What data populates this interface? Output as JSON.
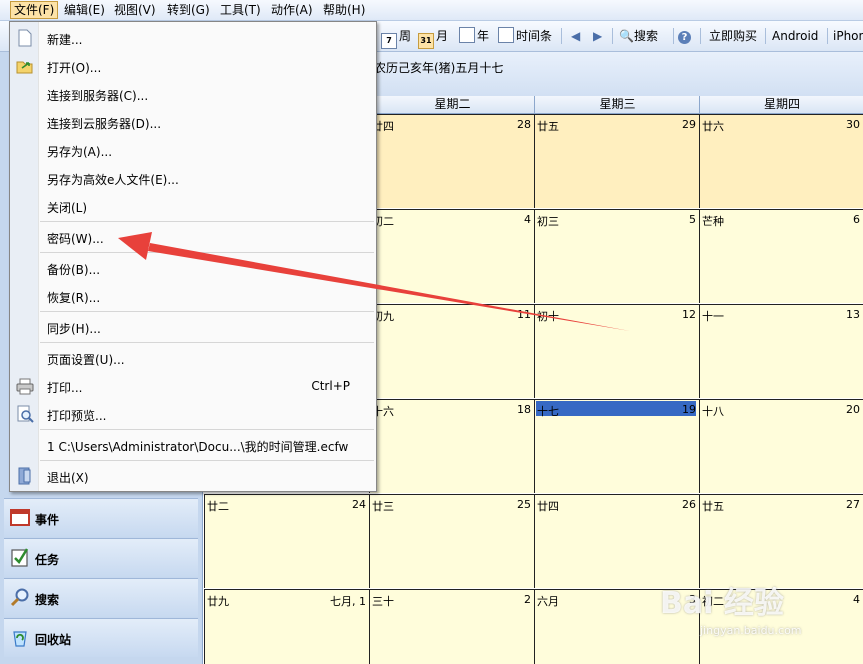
{
  "menubar": {
    "items": [
      {
        "label": "文件(F)"
      },
      {
        "label": "编辑(E)"
      },
      {
        "label": "视图(V)"
      },
      {
        "label": "转到(G)"
      },
      {
        "label": "工具(T)"
      },
      {
        "label": "动作(A)"
      },
      {
        "label": "帮助(H)"
      }
    ]
  },
  "toolbar": {
    "week_label": "周",
    "month_label": "月",
    "month_icon_text": "31",
    "year_label": "年",
    "timeline_label": "时间条",
    "search_label": "搜索",
    "buy_label": "立即购买",
    "android_label": "Android",
    "iphone_label": "iPhon"
  },
  "date_header": {
    "lunar_text": "农历己亥年(猪)五月十七"
  },
  "calendar": {
    "weekday_headers": [
      "星期二",
      "星期三",
      "星期四"
    ],
    "rows": [
      [
        {
          "lunar": "廿四",
          "day": "28"
        },
        {
          "lunar": "廿五",
          "day": "29"
        },
        {
          "lunar": "廿六",
          "day": "30"
        }
      ],
      [
        {
          "lunar": "初二",
          "day": "4"
        },
        {
          "lunar": "初三",
          "day": "5"
        },
        {
          "lunar": "芒种",
          "day": "6"
        }
      ],
      [
        {
          "lunar": "初九",
          "day": "11"
        },
        {
          "lunar": "初十",
          "day": "12"
        },
        {
          "lunar": "十一",
          "day": "13"
        }
      ],
      [
        {
          "lunar": "十六",
          "day": "18"
        },
        {
          "lunar": "十七",
          "day": "19"
        },
        {
          "lunar": "十八",
          "day": "20"
        }
      ],
      [
        {
          "lunar": "廿二",
          "day": "24"
        },
        {
          "lunar": "廿三",
          "day": "25"
        },
        {
          "lunar": "廿四",
          "day": "26"
        },
        {
          "lunar": "廿五",
          "day": "27"
        }
      ],
      [
        {
          "lunar": "廿九",
          "day": "七月, 1"
        },
        {
          "lunar": "三十",
          "day": "2"
        },
        {
          "lunar": "六月",
          "day": "3"
        },
        {
          "lunar": "初二",
          "day": "4"
        }
      ]
    ],
    "selected_day": "19"
  },
  "nav": {
    "events": "事件",
    "tasks": "任务",
    "search": "搜索",
    "recycle": "回收站"
  },
  "file_menu": {
    "new": "新建...",
    "open": "打开(O)...",
    "connect_server": "连接到服务器(C)...",
    "connect_cloud": "连接到云服务器(D)...",
    "save_as": "另存为(A)...",
    "save_as_ecf": "另存为高效e人文件(E)...",
    "close": "关闭(L)",
    "password": "密码(W)...",
    "backup": "备份(B)...",
    "restore": "恢复(R)...",
    "sync": "同步(H)...",
    "page_setup": "页面设置(U)...",
    "print": "打印...",
    "print_shortcut": "Ctrl+P",
    "print_preview": "打印预览...",
    "recent_file": "1 C:\\Users\\Administrator\\Docu...\\我的时间管理.ecfw",
    "exit": "退出(X)"
  },
  "watermark": {
    "brand": "Bai 经验",
    "url": "jingyan.baidu.com"
  },
  "colors": {
    "selected_day_bg": "#3669c4",
    "arrow": "#e8413b",
    "cell_bg": "#fffddb"
  }
}
